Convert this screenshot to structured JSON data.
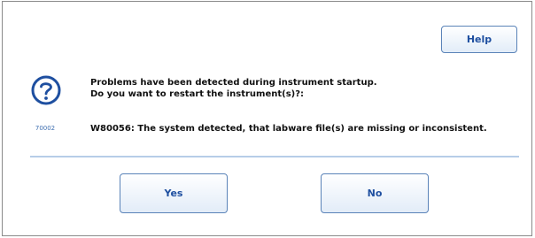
{
  "dialog": {
    "help_label": "Help",
    "icon": "question-circle-icon",
    "icon_code": "70002",
    "message_line1": "Problems have been detected during instrument startup.",
    "message_line2": "Do you want to restart the instrument(s)?:",
    "detail": "W80056: The system detected, that labware file(s) are missing or inconsistent.",
    "yes_label": "Yes",
    "no_label": "No"
  },
  "colors": {
    "accent": "#1e4fa0",
    "button_border": "#5a83b8",
    "divider": "#b7cde8"
  }
}
